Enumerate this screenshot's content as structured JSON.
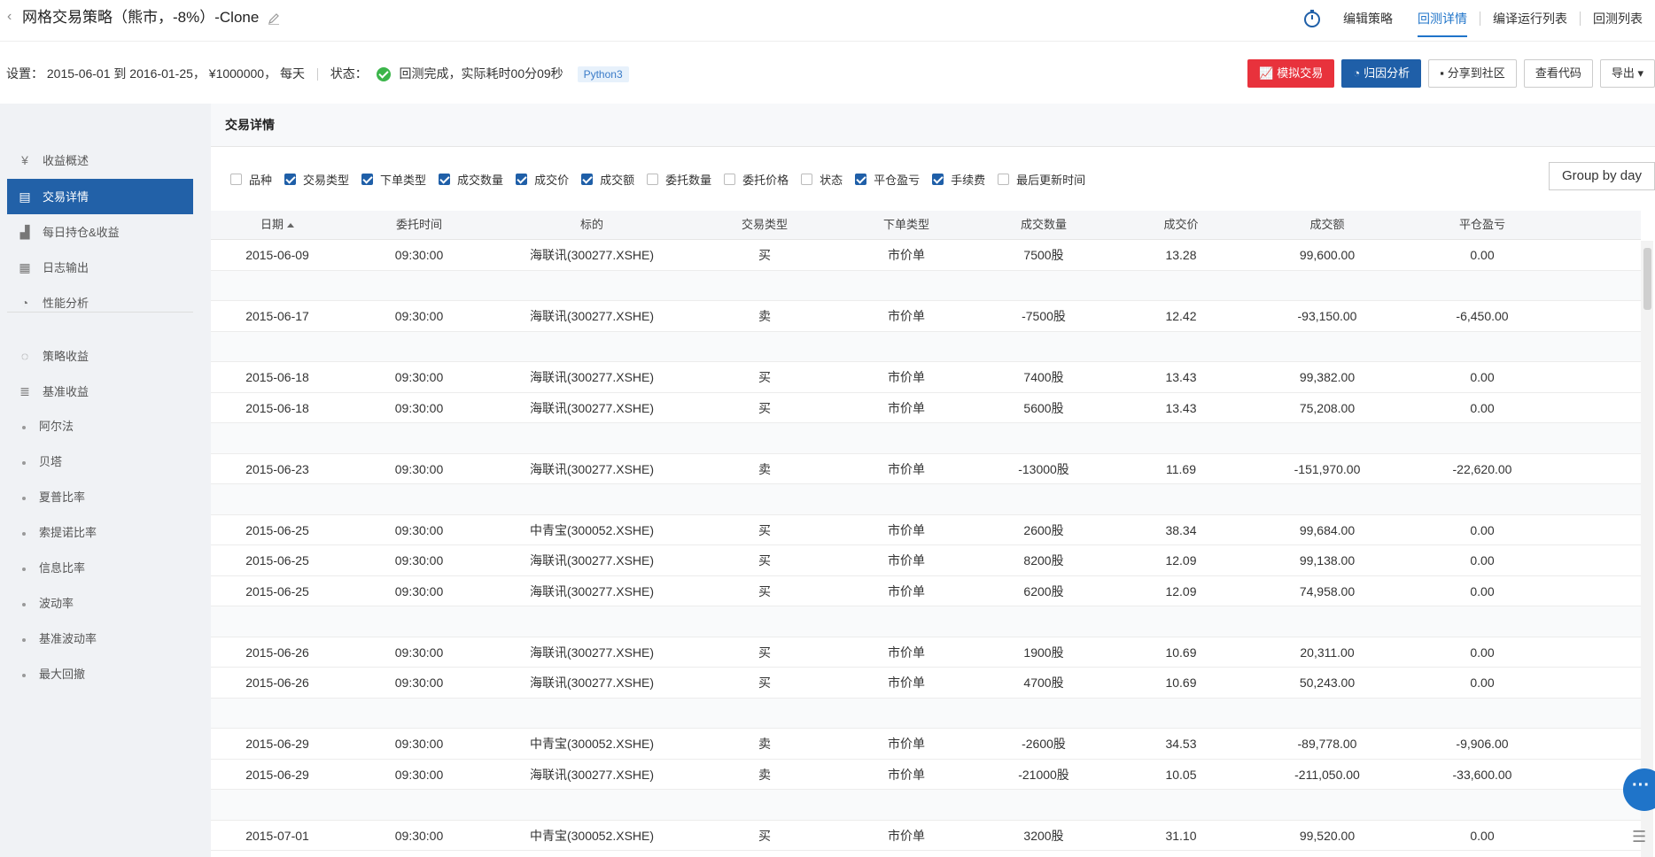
{
  "header": {
    "title": "网格交易策略（熊市，-8%）-Clone",
    "nav": [
      {
        "label": "编辑策略",
        "active": false
      },
      {
        "label": "回测详情",
        "active": true
      },
      {
        "label": "编译运行列表",
        "active": false
      },
      {
        "label": "回测列表",
        "active": false
      }
    ]
  },
  "settings": {
    "text": "设置：  2015-06-01 到 2016-01-25，  ¥1000000，  每天",
    "status_label": "状态：",
    "status_text": "回测完成，实际耗时00分09秒",
    "language": "Python3"
  },
  "actions": {
    "simulate": "模拟交易",
    "attribution": "归因分析",
    "share": "分享到社区",
    "view_code": "查看代码",
    "export": "导出"
  },
  "sidebar": {
    "items": [
      {
        "label": "收益概述",
        "icon": "yen-icon"
      },
      {
        "label": "交易详情",
        "icon": "doc-icon",
        "active": true
      },
      {
        "label": "每日持仓&收益",
        "icon": "bar-chart-icon"
      },
      {
        "label": "日志输出",
        "icon": "calendar-icon"
      },
      {
        "label": "性能分析",
        "icon": "pie-icon"
      }
    ],
    "items2": [
      {
        "label": "策略收益",
        "icon": "bulb-icon"
      },
      {
        "label": "基准收益",
        "icon": "database-icon"
      }
    ],
    "subitems": [
      "阿尔法",
      "贝塔",
      "夏普比率",
      "索提诺比率",
      "信息比率",
      "波动率",
      "基准波动率",
      "最大回撤"
    ]
  },
  "panel": {
    "title": "交易详情",
    "group_by": "Group by day"
  },
  "filters": [
    {
      "label": "品种",
      "checked": false
    },
    {
      "label": "交易类型",
      "checked": true
    },
    {
      "label": "下单类型",
      "checked": true
    },
    {
      "label": "成交数量",
      "checked": true
    },
    {
      "label": "成交价",
      "checked": true
    },
    {
      "label": "成交额",
      "checked": true
    },
    {
      "label": "委托数量",
      "checked": false
    },
    {
      "label": "委托价格",
      "checked": false
    },
    {
      "label": "状态",
      "checked": false
    },
    {
      "label": "平仓盈亏",
      "checked": true
    },
    {
      "label": "手续费",
      "checked": true
    },
    {
      "label": "最后更新时间",
      "checked": false
    }
  ],
  "table": {
    "columns": [
      "日期",
      "委托时间",
      "标的",
      "交易类型",
      "下单类型",
      "成交数量",
      "成交价",
      "成交额",
      "平仓盈亏"
    ],
    "rows": [
      [
        "2015-06-09",
        "09:30:00",
        "海联讯(300277.XSHE)",
        "买",
        "市价单",
        "7500股",
        "13.28",
        "99,600.00",
        "0.00"
      ],
      [],
      [
        "2015-06-17",
        "09:30:00",
        "海联讯(300277.XSHE)",
        "卖",
        "市价单",
        "-7500股",
        "12.42",
        "-93,150.00",
        "-6,450.00"
      ],
      [],
      [
        "2015-06-18",
        "09:30:00",
        "海联讯(300277.XSHE)",
        "买",
        "市价单",
        "7400股",
        "13.43",
        "99,382.00",
        "0.00"
      ],
      [
        "2015-06-18",
        "09:30:00",
        "海联讯(300277.XSHE)",
        "买",
        "市价单",
        "5600股",
        "13.43",
        "75,208.00",
        "0.00"
      ],
      [],
      [
        "2015-06-23",
        "09:30:00",
        "海联讯(300277.XSHE)",
        "卖",
        "市价单",
        "-13000股",
        "11.69",
        "-151,970.00",
        "-22,620.00"
      ],
      [],
      [
        "2015-06-25",
        "09:30:00",
        "中青宝(300052.XSHE)",
        "买",
        "市价单",
        "2600股",
        "38.34",
        "99,684.00",
        "0.00"
      ],
      [
        "2015-06-25",
        "09:30:00",
        "海联讯(300277.XSHE)",
        "买",
        "市价单",
        "8200股",
        "12.09",
        "99,138.00",
        "0.00"
      ],
      [
        "2015-06-25",
        "09:30:00",
        "海联讯(300277.XSHE)",
        "买",
        "市价单",
        "6200股",
        "12.09",
        "74,958.00",
        "0.00"
      ],
      [],
      [
        "2015-06-26",
        "09:30:00",
        "海联讯(300277.XSHE)",
        "买",
        "市价单",
        "1900股",
        "10.69",
        "20,311.00",
        "0.00"
      ],
      [
        "2015-06-26",
        "09:30:00",
        "海联讯(300277.XSHE)",
        "买",
        "市价单",
        "4700股",
        "10.69",
        "50,243.00",
        "0.00"
      ],
      [],
      [
        "2015-06-29",
        "09:30:00",
        "中青宝(300052.XSHE)",
        "卖",
        "市价单",
        "-2600股",
        "34.53",
        "-89,778.00",
        "-9,906.00"
      ],
      [
        "2015-06-29",
        "09:30:00",
        "海联讯(300277.XSHE)",
        "卖",
        "市价单",
        "-21000股",
        "10.05",
        "-211,050.00",
        "-33,600.00"
      ],
      [],
      [
        "2015-07-01",
        "09:30:00",
        "中青宝(300052.XSHE)",
        "买",
        "市价单",
        "3200股",
        "31.10",
        "99,520.00",
        "0.00"
      ]
    ]
  },
  "colors": {
    "accent": "#1f74c9",
    "active_side": "#2261a8",
    "red": "#e8323c",
    "ok": "#3bb54a"
  }
}
